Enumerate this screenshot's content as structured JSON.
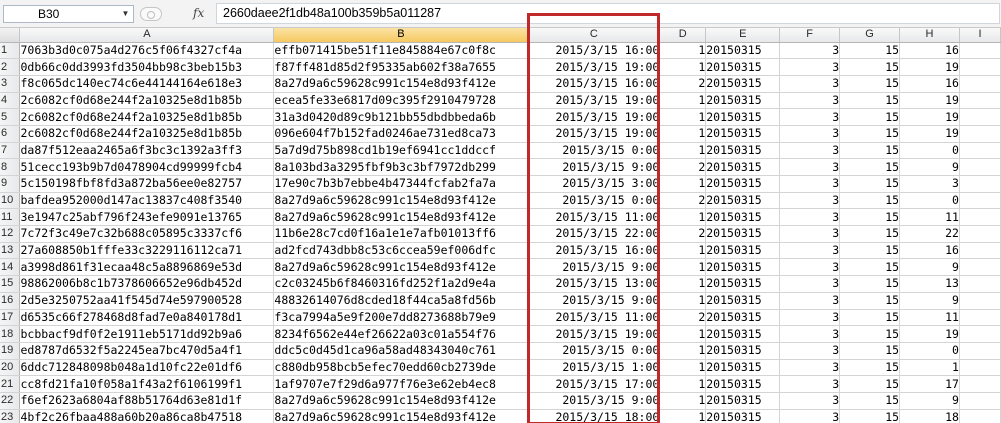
{
  "formula_bar": {
    "name_box": "B30",
    "fx_label": "fx",
    "formula": "2660daee2f1db48a100b359b5a011287"
  },
  "columns": [
    "A",
    "B",
    "C",
    "D",
    "E",
    "F",
    "G",
    "H",
    "I"
  ],
  "rows": [
    {
      "n": "1",
      "a": "7063b3d0c075a4d276c5f06f4327cf4a",
      "b": "effb071415be51f11e845884e67c0f8c",
      "c": "2015/3/15 16:00",
      "d": "1",
      "e": "20150315",
      "f": "3",
      "g": "15",
      "h": "16"
    },
    {
      "n": "2",
      "a": "0db66c0dd3993fd3504bb98c3beb15b3",
      "b": "f87ff481d85d2f95335ab602f38a7655",
      "c": "2015/3/15 19:00",
      "d": "1",
      "e": "20150315",
      "f": "3",
      "g": "15",
      "h": "19"
    },
    {
      "n": "3",
      "a": "f8c065dc140ec74c6e44144164e618e3",
      "b": "8a27d9a6c59628c991c154e8d93f412e",
      "c": "2015/3/15 16:00",
      "d": "2",
      "e": "20150315",
      "f": "3",
      "g": "15",
      "h": "16"
    },
    {
      "n": "4",
      "a": "2c6082cf0d68e244f2a10325e8d1b85b",
      "b": "ecea5fe33e6817d09c395f2910479728",
      "c": "2015/3/15 19:00",
      "d": "1",
      "e": "20150315",
      "f": "3",
      "g": "15",
      "h": "19"
    },
    {
      "n": "5",
      "a": "2c6082cf0d68e244f2a10325e8d1b85b",
      "b": "31a3d0420d89c9b121bb55dbdbbeda6b",
      "c": "2015/3/15 19:00",
      "d": "1",
      "e": "20150315",
      "f": "3",
      "g": "15",
      "h": "19"
    },
    {
      "n": "6",
      "a": "2c6082cf0d68e244f2a10325e8d1b85b",
      "b": "096e604f7b152fad0246ae731ed8ca73",
      "c": "2015/3/15 19:00",
      "d": "1",
      "e": "20150315",
      "f": "3",
      "g": "15",
      "h": "19"
    },
    {
      "n": "7",
      "a": "da87f512eaa2465a6f3bc3c1392a3ff3",
      "b": "5a7d9d75b898cd1b19ef6941cc1ddccf",
      "c": "2015/3/15 0:00",
      "d": "1",
      "e": "20150315",
      "f": "3",
      "g": "15",
      "h": "0"
    },
    {
      "n": "8",
      "a": "51cecc193b9b7d0478904cd99999fcb4",
      "b": "8a103bd3a3295fbf9b3c3bf7972db299",
      "c": "2015/3/15 9:00",
      "d": "2",
      "e": "20150315",
      "f": "3",
      "g": "15",
      "h": "9"
    },
    {
      "n": "9",
      "a": "5c150198fbf8fd3a872ba56ee0e82757",
      "b": "17e90c7b3b7ebbe4b47344fcfab2fa7a",
      "c": "2015/3/15 3:00",
      "d": "1",
      "e": "20150315",
      "f": "3",
      "g": "15",
      "h": "3"
    },
    {
      "n": "10",
      "a": "bafdea952000d147ac13837c408f3540",
      "b": "8a27d9a6c59628c991c154e8d93f412e",
      "c": "2015/3/15 0:00",
      "d": "2",
      "e": "20150315",
      "f": "3",
      "g": "15",
      "h": "0"
    },
    {
      "n": "11",
      "a": "3e1947c25abf796f243efe9091e13765",
      "b": "8a27d9a6c59628c991c154e8d93f412e",
      "c": "2015/3/15 11:00",
      "d": "1",
      "e": "20150315",
      "f": "3",
      "g": "15",
      "h": "11"
    },
    {
      "n": "12",
      "a": "7c72f3c49e7c32b688c05895c3337cf6",
      "b": "11b6e28c7cd0f16a1e1e7afb01013ff6",
      "c": "2015/3/15 22:00",
      "d": "2",
      "e": "20150315",
      "f": "3",
      "g": "15",
      "h": "22"
    },
    {
      "n": "13",
      "a": "27a608850b1fffe33c3229116112ca71",
      "b": "ad2fcd743dbb8c53c6ccea59ef006dfc",
      "c": "2015/3/15 16:00",
      "d": "1",
      "e": "20150315",
      "f": "3",
      "g": "15",
      "h": "16"
    },
    {
      "n": "14",
      "a": "a3998d861f31ecaa48c5a8896869e53d",
      "b": "8a27d9a6c59628c991c154e8d93f412e",
      "c": "2015/3/15 9:00",
      "d": "1",
      "e": "20150315",
      "f": "3",
      "g": "15",
      "h": "9"
    },
    {
      "n": "15",
      "a": "98862006b8c1b7378606652e96db452d",
      "b": "c2c03245b6f8460316fd252f1a2d9e4a",
      "c": "2015/3/15 13:00",
      "d": "1",
      "e": "20150315",
      "f": "3",
      "g": "15",
      "h": "13"
    },
    {
      "n": "16",
      "a": "2d5e3250752aa41f545d74e597900528",
      "b": "48832614076d8cded18f44ca5a8fd56b",
      "c": "2015/3/15 9:00",
      "d": "1",
      "e": "20150315",
      "f": "3",
      "g": "15",
      "h": "9"
    },
    {
      "n": "17",
      "a": "d6535c66f278468d8fad7e0a840178d1",
      "b": "f3ca7994a5e9f200e7dd8273688b79e9",
      "c": "2015/3/15 11:00",
      "d": "2",
      "e": "20150315",
      "f": "3",
      "g": "15",
      "h": "11"
    },
    {
      "n": "18",
      "a": "bcbbacf9df0f2e1911eb5171dd92b9a6",
      "b": "8234f6562e44ef26622a03c01a554f76",
      "c": "2015/3/15 19:00",
      "d": "1",
      "e": "20150315",
      "f": "3",
      "g": "15",
      "h": "19"
    },
    {
      "n": "19",
      "a": "ed8787d6532f5a2245ea7bc470d5a4f1",
      "b": "ddc5c0d45d1ca96a58ad48343040c761",
      "c": "2015/3/15 0:00",
      "d": "1",
      "e": "20150315",
      "f": "3",
      "g": "15",
      "h": "0"
    },
    {
      "n": "20",
      "a": "6ddc712848098b048a1d10fc22e01df6",
      "b": "c880db958bcb5efec70edd60cb2739de",
      "c": "2015/3/15 1:00",
      "d": "1",
      "e": "20150315",
      "f": "3",
      "g": "15",
      "h": "1"
    },
    {
      "n": "21",
      "a": "cc8fd21fa10f058a1f43a2f6106199f1",
      "b": "1af9707e7f29d6a977f76e3e62eb4ec8",
      "c": "2015/3/15 17:00",
      "d": "1",
      "e": "20150315",
      "f": "3",
      "g": "15",
      "h": "17"
    },
    {
      "n": "22",
      "a": "f6ef2623a6804af88b51764d63e81d1f",
      "b": "8a27d9a6c59628c991c154e8d93f412e",
      "c": "2015/3/15 9:00",
      "d": "1",
      "e": "20150315",
      "f": "3",
      "g": "15",
      "h": "9"
    },
    {
      "n": "23",
      "a": "4bf2c26fbaa488a60b20a86ca8b47518",
      "b": "8a27d9a6c59628c991c154e8d93f412e",
      "c": "2015/3/15 18:00",
      "d": "1",
      "e": "20150315",
      "f": "3",
      "g": "15",
      "h": "18"
    }
  ],
  "colors": {
    "highlight_box": "#c0282a",
    "selected_column_header": "#f6c961",
    "gridline": "#d4d4d4",
    "header_bg": "#e7e8ea"
  },
  "selected_column": "B",
  "highlighted_column": "C"
}
